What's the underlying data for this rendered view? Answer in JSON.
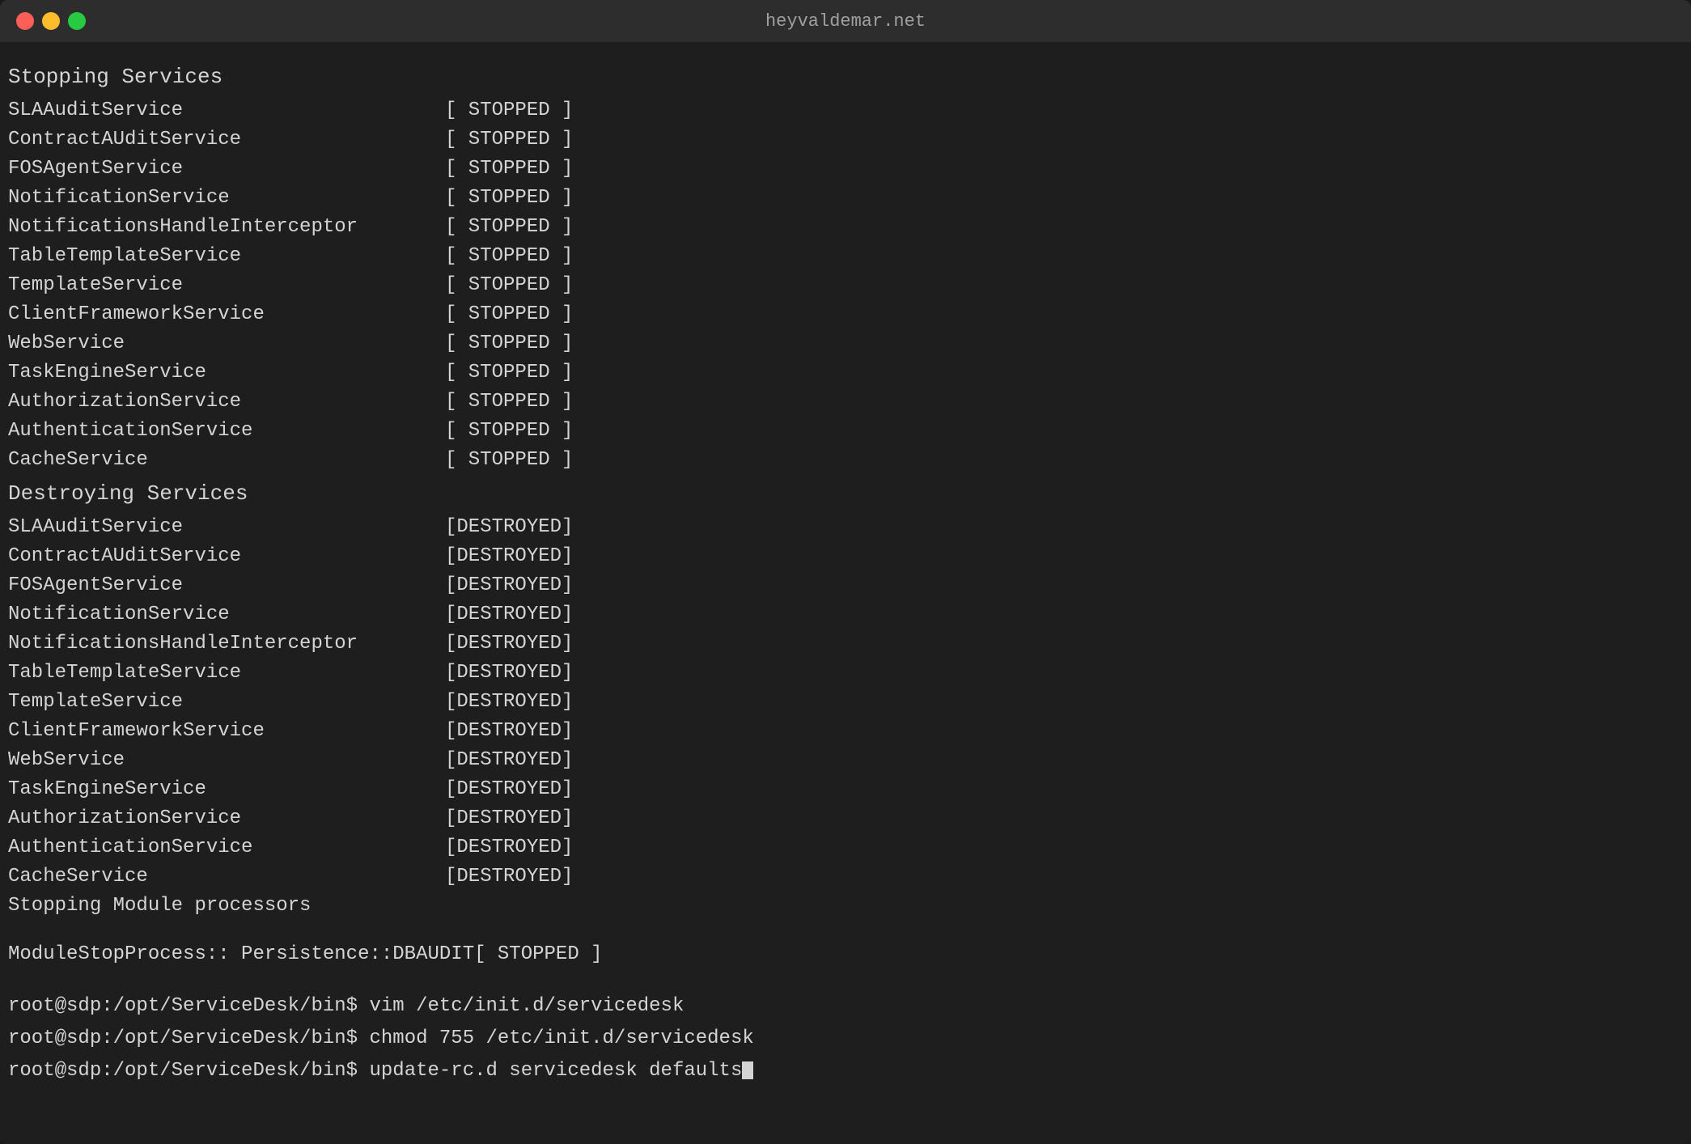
{
  "window": {
    "title": "heyvaldemar.net",
    "buttons": {
      "close": "close",
      "minimize": "minimize",
      "maximize": "maximize"
    }
  },
  "terminal": {
    "stopping_header": "Stopping Services",
    "stopping_services": [
      {
        "name": "SLAAuditService",
        "status": "[ STOPPED ]"
      },
      {
        "name": "ContractAUditService",
        "status": "[ STOPPED ]"
      },
      {
        "name": "FOSAgentService",
        "status": "[ STOPPED ]"
      },
      {
        "name": "NotificationService",
        "status": "[ STOPPED ]"
      },
      {
        "name": "NotificationsHandleInterceptor",
        "status": "[ STOPPED ]"
      },
      {
        "name": "TableTemplateService",
        "status": "[ STOPPED ]"
      },
      {
        "name": "TemplateService",
        "status": "[ STOPPED ]"
      },
      {
        "name": "ClientFrameworkService",
        "status": "[ STOPPED ]"
      },
      {
        "name": "WebService",
        "status": "[ STOPPED ]"
      },
      {
        "name": "TaskEngineService",
        "status": "[ STOPPED ]"
      },
      {
        "name": "AuthorizationService",
        "status": "[ STOPPED ]"
      },
      {
        "name": "AuthenticationService",
        "status": "[ STOPPED ]"
      },
      {
        "name": "CacheService",
        "status": "[ STOPPED ]"
      }
    ],
    "destroying_header": "Destroying Services",
    "destroying_services": [
      {
        "name": "SLAAuditService",
        "status": "[DESTROYED]"
      },
      {
        "name": "ContractAUditService",
        "status": "[DESTROYED]"
      },
      {
        "name": "FOSAgentService",
        "status": "[DESTROYED]"
      },
      {
        "name": "NotificationService",
        "status": "[DESTROYED]"
      },
      {
        "name": "NotificationsHandleInterceptor",
        "status": "[DESTROYED]"
      },
      {
        "name": "TableTemplateService",
        "status": "[DESTROYED]"
      },
      {
        "name": "TemplateService",
        "status": "[DESTROYED]"
      },
      {
        "name": "ClientFrameworkService",
        "status": "[DESTROYED]"
      },
      {
        "name": "WebService",
        "status": "[DESTROYED]"
      },
      {
        "name": "TaskEngineService",
        "status": "[DESTROYED]"
      },
      {
        "name": "AuthorizationService",
        "status": "[DESTROYED]"
      },
      {
        "name": "AuthenticationService",
        "status": "[DESTROYED]"
      },
      {
        "name": "CacheService",
        "status": "[DESTROYED]"
      }
    ],
    "stopping_module": "Stopping Module processors",
    "module_stop": "ModuleStopProcess:: Persistence::DBAUDIT",
    "module_status": "[ STOPPED ]",
    "prompts": [
      {
        "prompt": "root@sdp:/opt/ServiceDesk/bin$",
        "command": " vim /etc/init.d/servicedesk"
      },
      {
        "prompt": "root@sdp:/opt/ServiceDesk/bin$",
        "command": " chmod 755 /etc/init.d/servicedesk"
      },
      {
        "prompt": "root@sdp:/opt/ServiceDesk/bin$",
        "command": " update-rc.d servicedesk defaults"
      }
    ]
  }
}
